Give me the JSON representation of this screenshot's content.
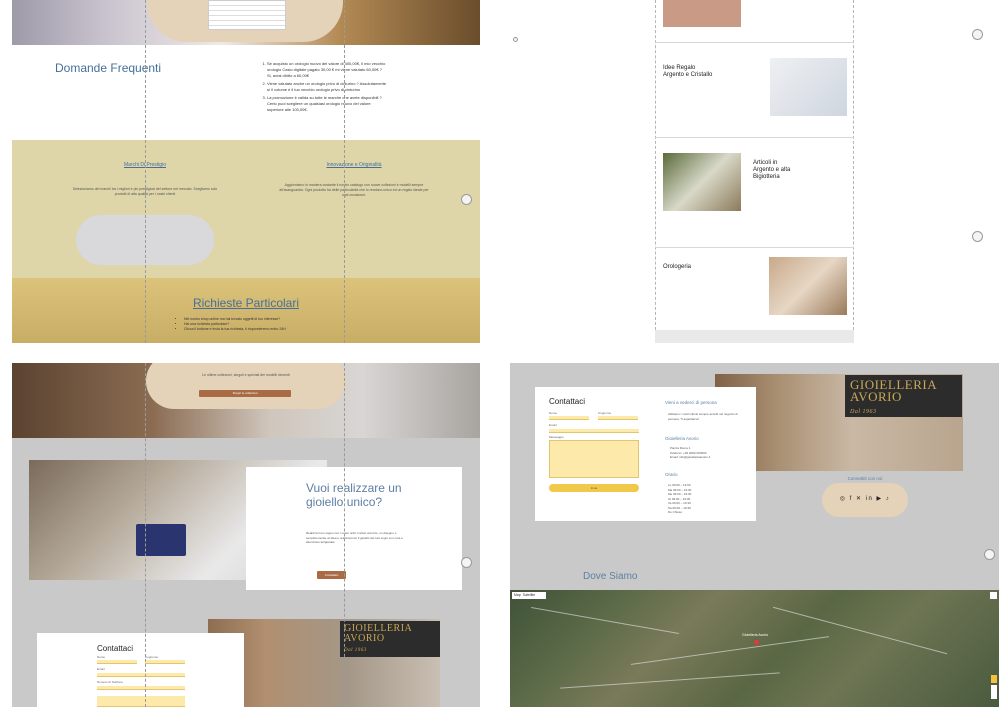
{
  "panel1": {
    "faq_title": "Domande Frequenti",
    "faq_items": [
      "Se acquisto un orologio nuovo del valore di 400,00€, il mio vecchio orologio Casio digitale pagato 30,00 € mi viene valutato 60,00€ ? Si, avrai diritto a 60,00€",
      "Viene valutato anche un orologio privo di cinturino ? Assolutamente sì il volume è il tuo vecchio orologio privo di cinturino",
      "La promozione è valida su tutte le marche che avete disponibili ? Certo puoi scegliere un qualsiasi orologio nuovo del valore superiore alle 100,00€."
    ],
    "brands_title": "Marchi Di Prestigio",
    "brands_text": "Selezioniamo dei marchi tra i migliori e più prestigiosi del settore nel mercato. Scegliamo solo prodotti di alta qualità per i nostri clienti",
    "innovation_title": "Innovazione e Originalità",
    "innovation_text": "Aggiorniamo in maniera costante il nostro catalogo con nuove collezioni e modelli sempre all'avanguardia. Ogni prodotto ha delle particolarità che lo rendono unico ed un regalo ideale per ogni occasione.",
    "requests_title": "Richieste Particolari",
    "requests_items": [
      "Nel nostro shop online ma hai trovato oggetti di tuo interesse?",
      "Hai una richiesta particolare?",
      "Clicca il bottone e invia la tua richiesta, ti risponderemo entro 24H"
    ]
  },
  "panel2": {
    "categories": [
      {
        "title": "Idee Regalo Argento e Cristallo"
      },
      {
        "title": "Articoli in Argento e alta Bigiotteria"
      },
      {
        "title": "Orologeria"
      }
    ]
  },
  "panel3": {
    "cap_text": "Le ultime collezioni, singoli e speciali dei modelli vincenti",
    "cap_button": "Scopri le collezioni",
    "custom_title": "Vuoi realizzare un gioiello unico?",
    "custom_text": "Realizza il tuo sogno con i nostri orafi. Inviaci una foto, un disegno o semplicemente un'idea e realizzeremo il gioiello dei tuoi sogni con cura e attenzione artigianale.",
    "custom_button": "Contattaci",
    "contact_title": "Contattaci",
    "shop_sign": "GIOIELLERIA AVORIO",
    "shop_sign_year": "Dal 1963",
    "fields": [
      "Nome",
      "Cognome",
      "Email",
      "Numero di Telefono"
    ]
  },
  "panel4": {
    "contact_title": "Contattaci",
    "labels": {
      "name": "Nome",
      "surname": "Cognome",
      "email": "Email",
      "message": "Messaggio",
      "send": "Invia"
    },
    "visit_title": "Vieni a vederci di persona",
    "visit_text": "Abbiamo i nostri clienti sempre accolti nel negozio di persona. Ti aspettiamo!",
    "store_title": "Gioielleria Avorio",
    "store_lines": [
      "Piazza Roma 1",
      "Telefono: +39 0000 000000",
      "Email: info@gioielleriaavorio.it"
    ],
    "hours_title": "Orario",
    "hours_lines": [
      "Lu 09:00 – 13:00",
      "Ma 09:00 – 19:30",
      "Me 09:00 – 19:30",
      "Gi 09:00 – 19:30",
      "Ve 09:00 – 19:30",
      "Sa 09:00 – 19:30",
      "Do Chiuso"
    ],
    "social_title": "Connettiti con noi",
    "social_icons": [
      "instagram-icon",
      "facebook-icon",
      "twitter-icon",
      "linkedin-icon",
      "youtube-icon",
      "tiktok-icon"
    ],
    "social_glyphs": "◎ f ✕ in ▶ ♪",
    "shop_sign": "GIOIELLERIA AVORIO",
    "shop_sign_year": "Dal 1963",
    "map_title": "Dove Siamo",
    "map_toggle": [
      "Map",
      "Satellite"
    ],
    "map_pin": "Gioielleria Avorio"
  }
}
